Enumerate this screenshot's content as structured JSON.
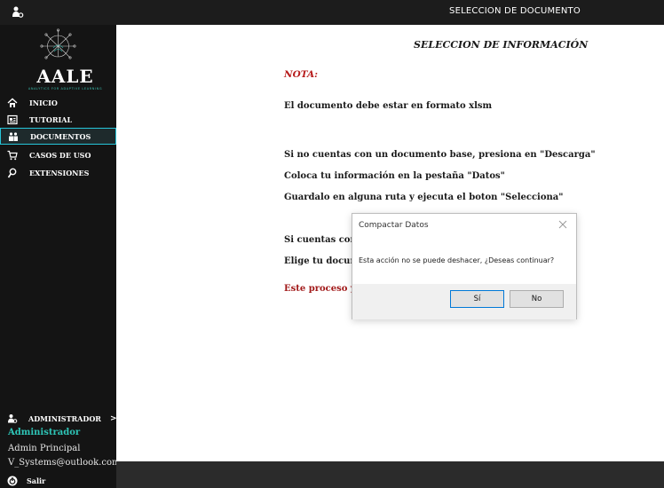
{
  "window": {
    "title": "SELECCION DE DOCUMENTO",
    "app_icon": "user-gear-icon"
  },
  "sidebar": {
    "logo": {
      "name": "AALE",
      "tagline": "ANALYTICS FOR ADAPTIVE LEARNING"
    },
    "items": [
      {
        "label": "INICIO",
        "icon": "home-icon"
      },
      {
        "label": "TUTORIAL",
        "icon": "tutorial-icon"
      },
      {
        "label": "DOCUMENTOS",
        "icon": "documents-icon",
        "active": true
      },
      {
        "label": "CASOS DE USO",
        "icon": "cart-icon"
      },
      {
        "label": "EXTENSIONES",
        "icon": "search-icon"
      }
    ],
    "admin": {
      "label": "ADMINISTRADOR",
      "arrow": ">"
    },
    "user": {
      "name": "Administrador",
      "role": "Admin Principal",
      "email": "V_Systems@outlook.com"
    },
    "logout": {
      "label": "Salir"
    }
  },
  "main": {
    "title": "SELECCION DE INFORMACIÓN",
    "nota": "NOTA:",
    "lines": [
      "El documento debe estar en formato xlsm",
      "Si no cuentas con un documento base, presiona en \"Descarga\"",
      "Coloca tu información en la pestaña \"Datos\"",
      "Guardalo en alguna ruta y ejecuta el boton \"Selecciona\"",
      "Si cuentas con",
      "Elige tu docum",
      "Este proceso y"
    ]
  },
  "dialog": {
    "title": "Compactar Datos",
    "message": "Esta acción no se puede deshacer, ¿Deseas continuar?",
    "buttons": {
      "yes": "Sí",
      "no": "No"
    }
  },
  "colors": {
    "sidebar_bg": "#141414",
    "accent": "#2ec4b6",
    "active_border": "#26c6da",
    "note_red": "#b71c1c"
  }
}
